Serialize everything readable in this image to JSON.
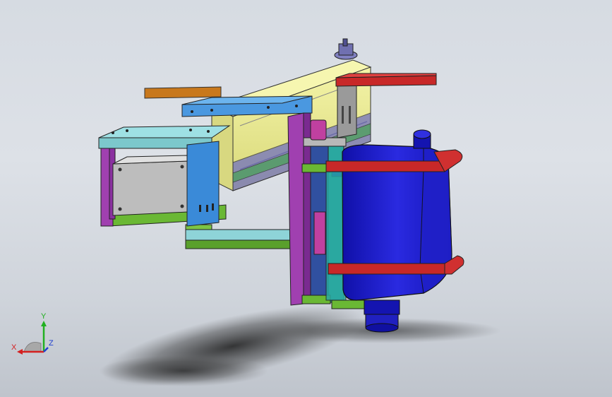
{
  "viewport": {
    "background_top": "#d6dbe2",
    "background_bottom": "#bfc4cc"
  },
  "triad": {
    "x_label": "X",
    "y_label": "Y",
    "z_label": "Z",
    "x_color": "#d42020",
    "y_color": "#20b020",
    "z_color": "#2040d0"
  },
  "model": {
    "colors": {
      "rail": "#ecec90",
      "brace_orange": "#c8781c",
      "plate_blue": "#3a8ad8",
      "plate_cyan": "#8ed4d8",
      "frame_purple": "#a040b0",
      "frame_green": "#6ab834",
      "motor_gray": "#b8b8b8",
      "clamp_red": "#c82828",
      "tank_blue": "#1818c8",
      "teal": "#2aa8a0",
      "magenta": "#c040a0"
    }
  }
}
